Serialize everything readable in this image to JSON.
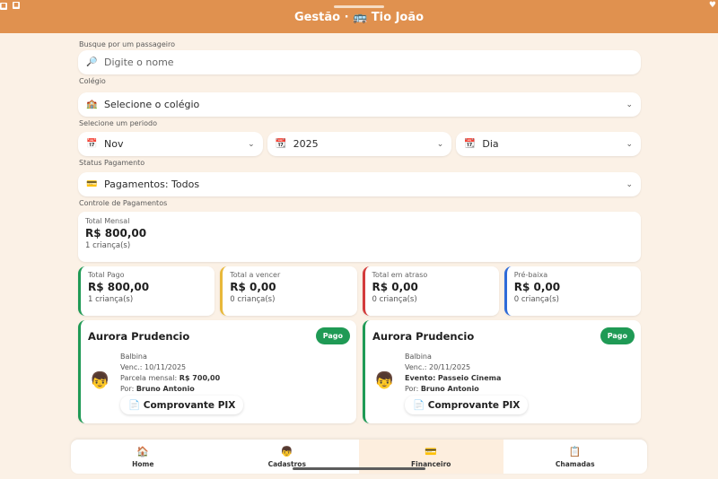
{
  "header": {
    "title": "Gestão · 🚌 Tio João"
  },
  "search": {
    "label": "Busque por um passageiro",
    "placeholder": "Digite o nome",
    "icon": "magnifier-icon"
  },
  "school": {
    "label": "Colégio",
    "value": "Selecione o colégio",
    "icon": "school-icon"
  },
  "period": {
    "label": "Selecione um periodo",
    "month": "Nov",
    "year": "2025",
    "day": "Dia"
  },
  "payment_status": {
    "label": "Status Pagamento",
    "value": "Pagamentos: Todos"
  },
  "control": {
    "label": "Controle de Pagamentos",
    "total": {
      "label": "Total Mensal",
      "value": "R$ 800,00",
      "count": "1 criança(s)"
    },
    "stats": [
      {
        "label": "Total Pago",
        "value": "R$ 800,00",
        "count": "1 criança(s)",
        "color": "#1f9a55"
      },
      {
        "label": "Total a vencer",
        "value": "R$ 0,00",
        "count": "0 criança(s)",
        "color": "#e8b83a"
      },
      {
        "label": "Total em atraso",
        "value": "R$ 0,00",
        "count": "0 criança(s)",
        "color": "#d33b3b"
      },
      {
        "label": "Pré-baixa",
        "value": "R$ 0,00",
        "count": "0 criança(s)",
        "color": "#2f6bd8"
      }
    ]
  },
  "payments": [
    {
      "name": "Aurora Prudencio",
      "badge": "Pago",
      "school": "Balbina",
      "due": "Venc.: 10/11/2025",
      "detail_label": "Parcela mensal:",
      "detail_value": "R$ 700,00",
      "by_label": "Por:",
      "by": "Bruno Antonio",
      "button": "Comprovante PIX"
    },
    {
      "name": "Aurora Prudencio",
      "badge": "Pago",
      "school": "Balbina",
      "due": "Venc.: 20/11/2025",
      "detail_label": "Evento:",
      "detail_value": "Passeio Cinema",
      "by_label": "Por:",
      "by": "Bruno Antonio",
      "button": "Comprovante PIX"
    }
  ],
  "tabs": [
    {
      "label": "Home",
      "icon": "🏠"
    },
    {
      "label": "Cadastros",
      "icon": "👦"
    },
    {
      "label": "Financeiro",
      "icon": "💳"
    },
    {
      "label": "Chamadas",
      "icon": "📋"
    }
  ],
  "colors": {
    "accent": "#e0914f",
    "background": "#fbf1e6",
    "paid": "#1f9a55"
  }
}
